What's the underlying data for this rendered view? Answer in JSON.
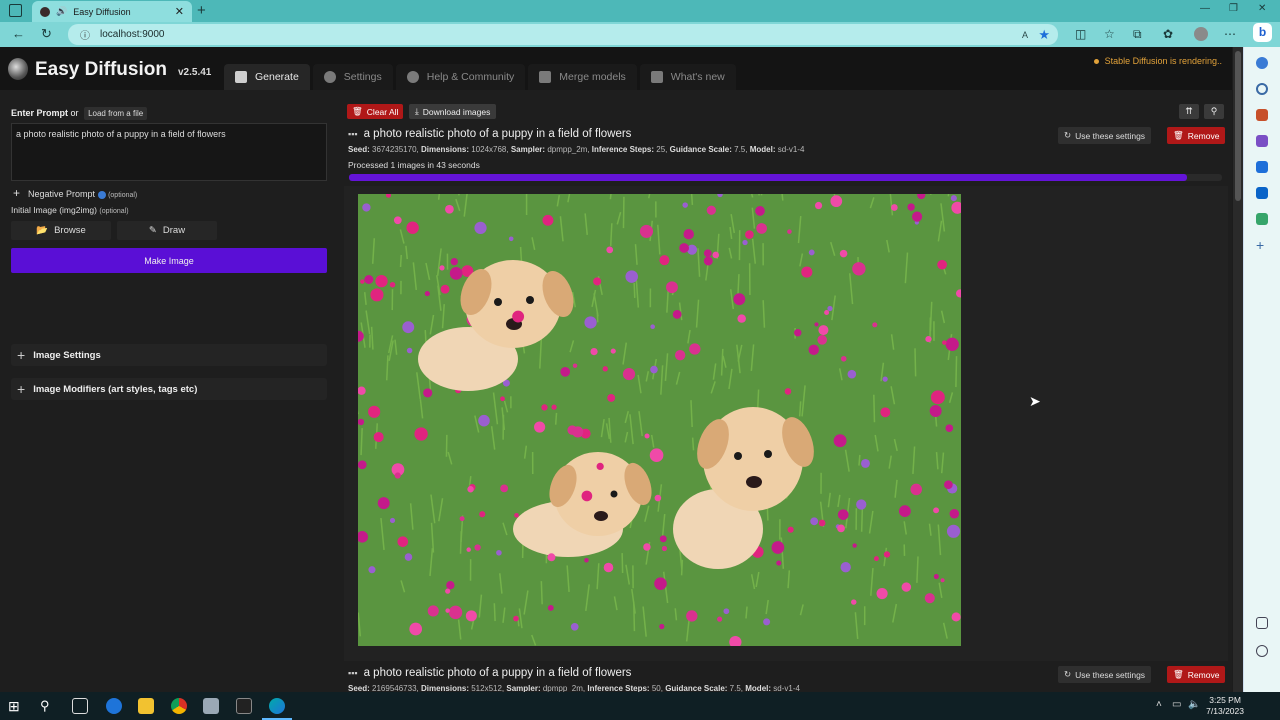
{
  "browser": {
    "tab_title": "Easy Diffusion",
    "url": "localhost:9000"
  },
  "app": {
    "title": "Easy Diffusion",
    "version": "v2.5.41",
    "status": "Stable Diffusion is rendering..",
    "tabs": [
      "Generate",
      "Settings",
      "Help & Community",
      "Merge models",
      "What's new"
    ]
  },
  "left": {
    "enter_prompt": "Enter Prompt",
    "or": "or",
    "load_file": "Load from a file",
    "prompt_value": "a photo realistic photo of a puppy in a field of flowers",
    "negative_prompt": "Negative Prompt",
    "optional": "(optional)",
    "initial_image": "Initial Image (img2img)",
    "browse": "Browse",
    "draw": "Draw",
    "make_image": "Make Image",
    "image_settings": "Image Settings",
    "image_modifiers": "Image Modifiers (art styles, tags etc)"
  },
  "toolbar": {
    "clear_all": "Clear All",
    "download_images": "Download images"
  },
  "tasks": [
    {
      "title": "a photo realistic photo of a puppy in a field of flowers",
      "seed_label": "Seed:",
      "seed": "3674235170,",
      "dim_label": "Dimensions:",
      "dim": "1024x768,",
      "sampler_label": "Sampler:",
      "sampler": "dpmpp_2m,",
      "steps_label": "Inference Steps:",
      "steps": "25,",
      "gs_label": "Guidance Scale:",
      "gs": "7.5,",
      "model_label": "Model:",
      "model": "sd-v1-4",
      "processed": "Processed 1 images in 43 seconds",
      "progress": 0.96,
      "use_settings": "Use these settings",
      "remove": "Remove"
    },
    {
      "title": "a photo realistic photo of a puppy in a field of flowers",
      "seed_label": "Seed:",
      "seed": "2169546733,",
      "dim_label": "Dimensions:",
      "dim": "512x512,",
      "sampler_label": "Sampler:",
      "sampler": "dpmpp_2m,",
      "steps_label": "Inference Steps:",
      "steps": "50,",
      "gs_label": "Guidance Scale:",
      "gs": "7.5,",
      "model_label": "Model:",
      "model": "sd-v1-4",
      "use_settings": "Use these settings",
      "remove": "Remove"
    }
  ],
  "taskbar": {
    "time": "3:25 PM",
    "date": "7/13/2023"
  },
  "colors": {
    "accent": "#5a0fd6",
    "remove": "#b01818",
    "status": "#e2a23a"
  }
}
